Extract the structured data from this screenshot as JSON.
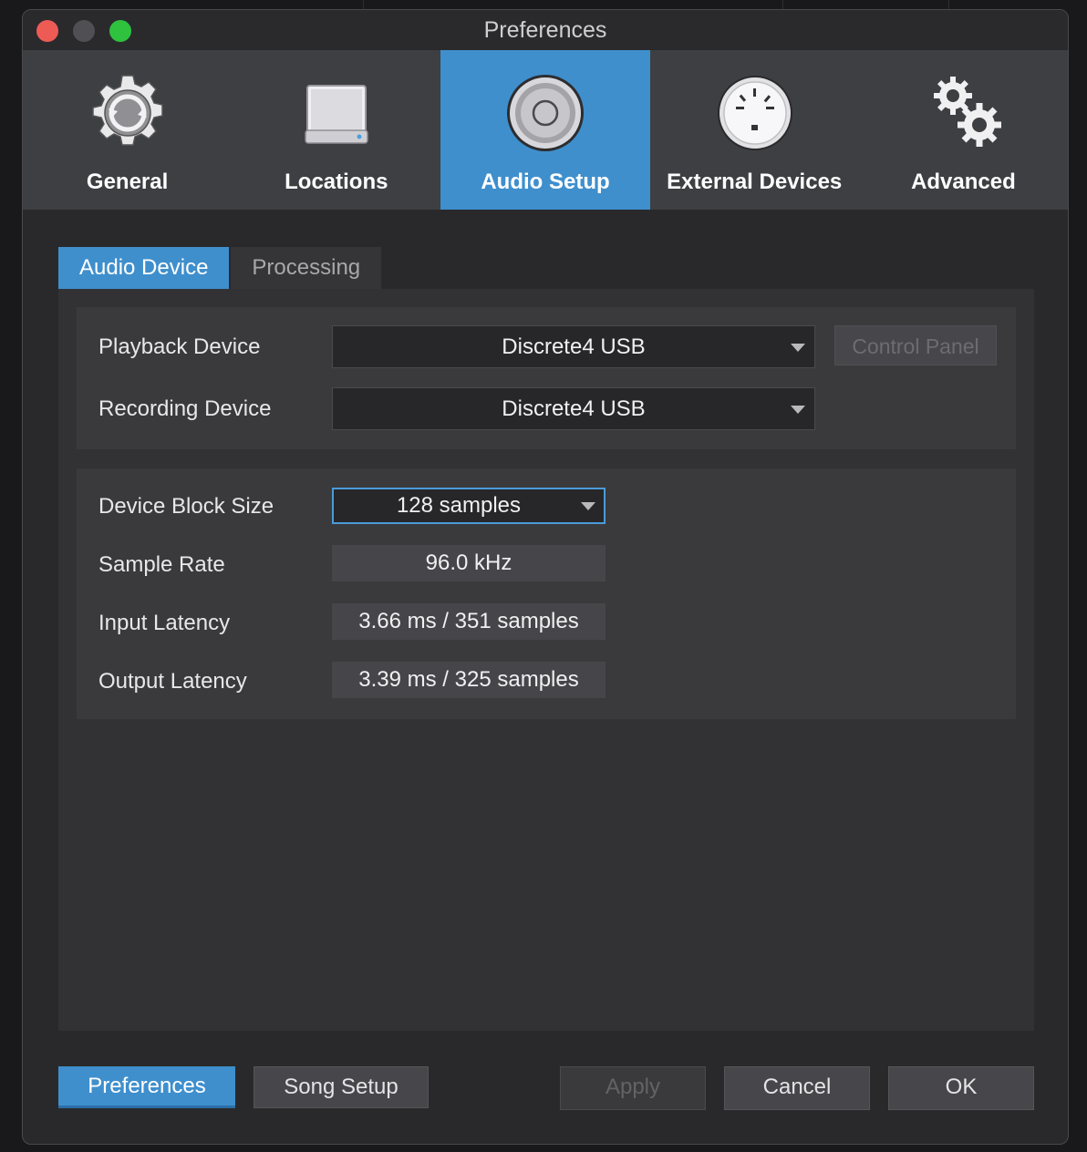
{
  "window": {
    "title": "Preferences"
  },
  "nav": {
    "items": [
      {
        "label": "General",
        "icon": "gear-sync-icon",
        "active": false
      },
      {
        "label": "Locations",
        "icon": "drive-icon",
        "active": false
      },
      {
        "label": "Audio Setup",
        "icon": "speaker-icon",
        "active": true
      },
      {
        "label": "External Devices",
        "icon": "midi-connector-icon",
        "active": false
      },
      {
        "label": "Advanced",
        "icon": "gears-icon",
        "active": false
      }
    ]
  },
  "subtabs": {
    "audio_device": "Audio Device",
    "processing": "Processing",
    "active": "Audio Device"
  },
  "devices": {
    "playback_label": "Playback Device",
    "playback_value": "Discrete4 USB",
    "recording_label": "Recording Device",
    "recording_value": "Discrete4 USB",
    "control_panel_label": "Control Panel"
  },
  "settings": {
    "block_size_label": "Device Block Size",
    "block_size_value": "128 samples",
    "sample_rate_label": "Sample Rate",
    "sample_rate_value": "96.0 kHz",
    "input_latency_label": "Input Latency",
    "input_latency_value": "3.66 ms / 351 samples",
    "output_latency_label": "Output Latency",
    "output_latency_value": "3.39 ms / 325 samples"
  },
  "footer": {
    "preferences": "Preferences",
    "song_setup": "Song Setup",
    "apply": "Apply",
    "cancel": "Cancel",
    "ok": "OK"
  },
  "colors": {
    "accent": "#3f8fcd",
    "nav_bg": "#3e3f43",
    "window_bg": "#29292b"
  }
}
